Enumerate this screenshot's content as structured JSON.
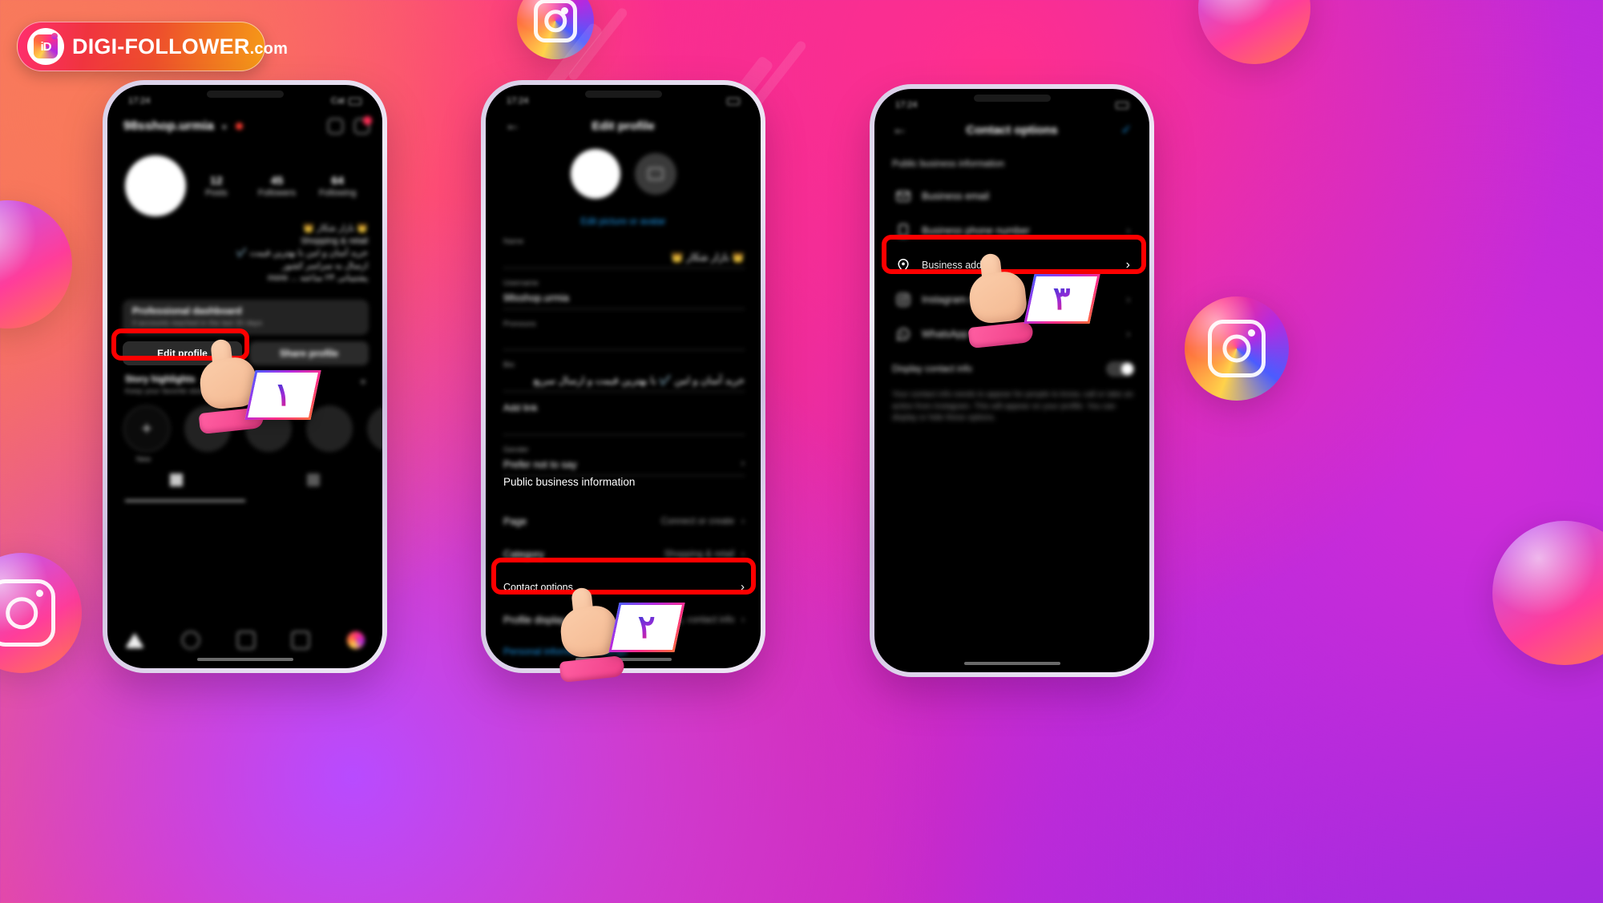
{
  "logo": {
    "mark_text": "iD",
    "brand": "DIGI-FOLLOWER",
    "tld": ".com"
  },
  "phone1": {
    "status": {
      "time": "17:24",
      "right": "Cat"
    },
    "profile": {
      "username": "98sshop.urmia",
      "chevron": "▾",
      "stats": [
        {
          "value": "12",
          "label": "Posts"
        },
        {
          "value": "45",
          "label": "Followers"
        },
        {
          "value": "64",
          "label": "Following"
        }
      ],
      "bio_lines": [
        "👑 بازار شکار 👑",
        "Shopping & retail",
        "خرید آسان و امن با بهترین قیمت ✔️",
        "ارسال به سراسر کشور",
        "پشتیبانی ۲۴ ساعته ... more"
      ],
      "dashboard": {
        "title": "Professional dashboard",
        "subtitle": "0 accounts reached in the last 30 days"
      },
      "buttons": {
        "edit": "Edit profile",
        "share": "Share profile"
      },
      "highlights": {
        "title": "Story highlights",
        "subtitle": "Keep your favorite stories on your profile",
        "plus": "+",
        "new_label": "New",
        "add_glyph": "+"
      }
    }
  },
  "phone2": {
    "status": {
      "time": "17:24"
    },
    "header": {
      "back": "←",
      "title": "Edit profile"
    },
    "edit_picture_link": "Edit picture or avatar",
    "fields": [
      {
        "label": "Name",
        "value": "👑 بازار شکار 👑"
      },
      {
        "label": "Username",
        "value": "98sshop.urmia"
      },
      {
        "label": "Pronouns",
        "value": ""
      },
      {
        "label": "Bio",
        "value": "خرید آسان و امن ✔️ با بهترین قیمت و ارسال سریع"
      },
      {
        "label": "Add link",
        "value": ""
      },
      {
        "label": "Gender",
        "value": "Prefer not to say"
      }
    ],
    "section_title": "Public business information",
    "rows": [
      {
        "label": "Page",
        "value": "Connect or create",
        "chevron": "›"
      },
      {
        "label": "Category",
        "value": "Shopping & retail",
        "chevron": "›"
      },
      {
        "label": "Contact options",
        "value": "",
        "chevron": "›"
      },
      {
        "label": "Profile display",
        "value": "Hide category, contact info",
        "chevron": "›"
      }
    ],
    "bottom_link": "Personal information settings"
  },
  "phone3": {
    "status": {
      "time": "17:24"
    },
    "header": {
      "back": "←",
      "title": "Contact options",
      "confirm": "✓"
    },
    "section_title": "Public business information",
    "rows": [
      {
        "icon": "email-icon",
        "label": "Business email",
        "chevron": ""
      },
      {
        "icon": "phone-icon",
        "label": "Business phone number",
        "chevron": "›"
      },
      {
        "icon": "location-pin-icon",
        "label": "Business address",
        "chevron": "›"
      },
      {
        "icon": "instagram-icon",
        "label": "Instagram contact",
        "chevron": "›"
      },
      {
        "icon": "whatsapp-icon",
        "label": "WhatsApp Business",
        "chevron": "›"
      }
    ],
    "toggle": {
      "label": "Display contact info",
      "state": "on"
    },
    "note": "Your contact info needs to appear for people to know, call or take an action from Instagram. This will appear on your profile. You can display or hide these options."
  },
  "steps": {
    "one": "۱",
    "two": "۲",
    "three": "۳"
  }
}
